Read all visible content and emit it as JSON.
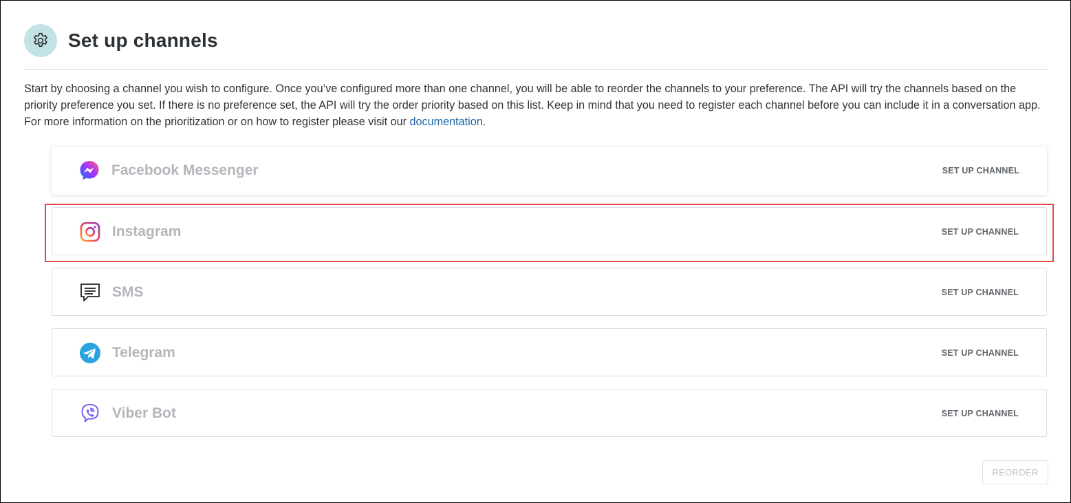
{
  "header": {
    "icon": "gear-icon",
    "title": "Set up channels"
  },
  "intro": {
    "text": "Start by choosing a channel you wish to configure. Once you’ve configured more than one channel, you will be able to reorder the channels to your preference. The API will try the channels based on the priority preference you set. If there is no preference set, the API will try the order priority based on this list. Keep in mind that you need to register each channel before you can include it in a conversation app. For more information on the prioritization or on how to register please visit our ",
    "link_label": "documentation",
    "trailing": "."
  },
  "channels": [
    {
      "name": "Facebook Messenger",
      "icon": "messenger-icon",
      "button": "SET UP CHANNEL"
    },
    {
      "name": "Instagram",
      "icon": "instagram-icon",
      "button": "SET UP CHANNEL"
    },
    {
      "name": "SMS",
      "icon": "sms-icon",
      "button": "SET UP CHANNEL"
    },
    {
      "name": "Telegram",
      "icon": "telegram-icon",
      "button": "SET UP CHANNEL"
    },
    {
      "name": "Viber Bot",
      "icon": "viber-icon",
      "button": "SET UP CHANNEL"
    }
  ],
  "footer": {
    "reorder_label": "REORDER"
  },
  "colors": {
    "accent": "#1e66a7",
    "gear_bg": "#c2e2e5",
    "highlight": "#e5484d",
    "channel_name": "#b3b6ba"
  }
}
